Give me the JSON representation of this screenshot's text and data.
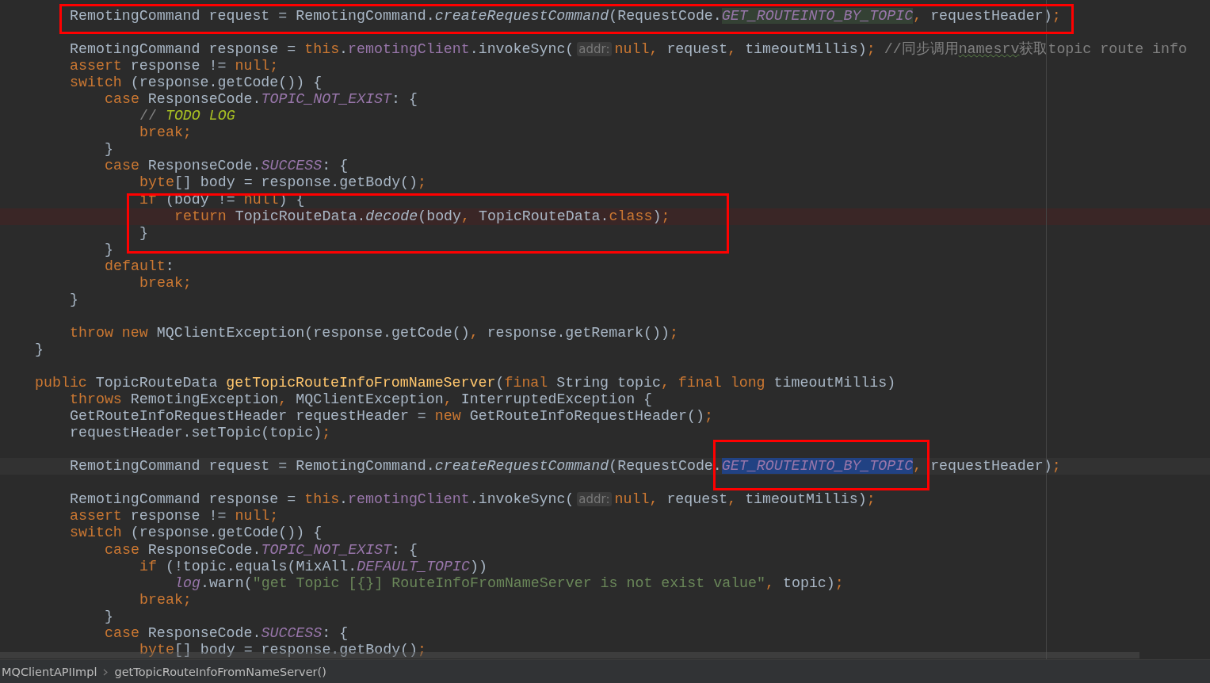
{
  "editor": {
    "lines": [
      {
        "kind": "group",
        "children": [
          {
            "kind": "code",
            "tokens": [
              {
                "kind": "plain",
                "text": "RemotingCommand request = RemotingCommand."
              },
              {
                "kind": "static",
                "text": "createRequestCommand"
              },
              {
                "kind": "plain",
                "text": "(RequestCode."
              },
              {
                "kind": "const-usage",
                "text": "GET_ROUTEINTO_BY_TOPIC"
              },
              {
                "kind": "kw",
                "text": ", "
              },
              {
                "kind": "plain",
                "text": "requestHeader)"
              },
              {
                "kind": "kw",
                "text": ";"
              }
            ]
          },
          {
            "kind": "blank"
          },
          {
            "kind": "code",
            "tokens": [
              {
                "kind": "plain",
                "text": "RemotingCommand response = "
              },
              {
                "kind": "kw",
                "text": "this"
              },
              {
                "kind": "plain",
                "text": "."
              },
              {
                "kind": "field",
                "text": "remotingClient"
              },
              {
                "kind": "plain",
                "text": ".invokeSync("
              },
              {
                "kind": "hint",
                "text": "addr:"
              },
              {
                "kind": "kw",
                "text": "null, "
              },
              {
                "kind": "plain",
                "text": "request"
              },
              {
                "kind": "kw",
                "text": ", "
              },
              {
                "kind": "plain",
                "text": "timeoutMillis)"
              },
              {
                "kind": "kw",
                "text": "; "
              },
              {
                "kind": "comment",
                "text": "//同步调用"
              },
              {
                "kind": "typo",
                "text": "namesrv"
              },
              {
                "kind": "comment",
                "text": "获取topic route info"
              }
            ]
          },
          {
            "kind": "code",
            "tokens": [
              {
                "kind": "kw",
                "text": "assert "
              },
              {
                "kind": "plain",
                "text": "response != "
              },
              {
                "kind": "kw",
                "text": "null;"
              }
            ]
          },
          {
            "kind": "code",
            "tokens": [
              {
                "kind": "kw",
                "text": "switch "
              },
              {
                "kind": "plain",
                "text": "(response.getCode()) {"
              }
            ],
            "children": [
              {
                "kind": "code",
                "tokens": [
                  {
                    "kind": "kw",
                    "text": "case "
                  },
                  {
                    "kind": "plain",
                    "text": "ResponseCode."
                  },
                  {
                    "kind": "const",
                    "text": "TOPIC_NOT_EXIST"
                  },
                  {
                    "kind": "plain",
                    "text": ": {"
                  }
                ],
                "children": [
                  {
                    "kind": "code",
                    "tokens": [
                      {
                        "kind": "comment",
                        "text": "// "
                      },
                      {
                        "kind": "todo",
                        "text": "TODO LOG"
                      }
                    ]
                  },
                  {
                    "kind": "code",
                    "tokens": [
                      {
                        "kind": "kw",
                        "text": "break;"
                      }
                    ]
                  }
                ]
              },
              {
                "kind": "code",
                "tokens": [
                  {
                    "kind": "plain",
                    "text": "}"
                  }
                ]
              },
              {
                "kind": "code",
                "tokens": [
                  {
                    "kind": "kw",
                    "text": "case "
                  },
                  {
                    "kind": "plain",
                    "text": "ResponseCode."
                  },
                  {
                    "kind": "const",
                    "text": "SUCCESS"
                  },
                  {
                    "kind": "plain",
                    "text": ": {"
                  }
                ],
                "children": [
                  {
                    "kind": "code",
                    "tokens": [
                      {
                        "kind": "kw",
                        "text": "byte"
                      },
                      {
                        "kind": "plain",
                        "text": "[] body = response.getBody()"
                      },
                      {
                        "kind": "kw",
                        "text": ";"
                      }
                    ]
                  },
                  {
                    "kind": "code",
                    "tokens": [
                      {
                        "kind": "kw",
                        "text": "if "
                      },
                      {
                        "kind": "plain",
                        "text": "(body != "
                      },
                      {
                        "kind": "kw",
                        "text": "null"
                      },
                      {
                        "kind": "plain",
                        "text": ") {"
                      }
                    ],
                    "children": [
                      {
                        "kind": "error-line",
                        "tokens": [
                          {
                            "kind": "kw",
                            "text": "return "
                          },
                          {
                            "kind": "plain",
                            "text": "TopicRouteData."
                          },
                          {
                            "kind": "static",
                            "text": "decode"
                          },
                          {
                            "kind": "plain",
                            "text": "(body"
                          },
                          {
                            "kind": "kw",
                            "text": ", "
                          },
                          {
                            "kind": "plain",
                            "text": "TopicRouteData."
                          },
                          {
                            "kind": "kw",
                            "text": "class"
                          },
                          {
                            "kind": "plain",
                            "text": ")"
                          },
                          {
                            "kind": "kw",
                            "text": ";"
                          }
                        ]
                      }
                    ]
                  },
                  {
                    "kind": "code",
                    "tokens": [
                      {
                        "kind": "plain",
                        "text": "}"
                      }
                    ]
                  }
                ]
              },
              {
                "kind": "code",
                "tokens": [
                  {
                    "kind": "plain",
                    "text": "}"
                  }
                ]
              },
              {
                "kind": "code",
                "tokens": [
                  {
                    "kind": "kw",
                    "text": "default"
                  },
                  {
                    "kind": "plain",
                    "text": ":"
                  }
                ],
                "children": [
                  {
                    "kind": "code",
                    "tokens": [
                      {
                        "kind": "kw",
                        "text": "break;"
                      }
                    ]
                  }
                ]
              }
            ]
          },
          {
            "kind": "code",
            "tokens": [
              {
                "kind": "plain",
                "text": "}"
              }
            ]
          },
          {
            "kind": "blank"
          },
          {
            "kind": "code",
            "tokens": [
              {
                "kind": "kw",
                "text": "throw new "
              },
              {
                "kind": "plain",
                "text": "MQClientException(response.getCode()"
              },
              {
                "kind": "kw",
                "text": ", "
              },
              {
                "kind": "plain",
                "text": "response.getRemark())"
              },
              {
                "kind": "kw",
                "text": ";"
              }
            ]
          }
        ]
      },
      {
        "kind": "code",
        "tokens": [
          {
            "kind": "plain",
            "text": "}"
          }
        ]
      },
      {
        "kind": "blank"
      },
      {
        "kind": "code",
        "tokens": [
          {
            "kind": "kw",
            "text": "public "
          },
          {
            "kind": "plain",
            "text": "TopicRouteData "
          },
          {
            "kind": "decl",
            "text": "getTopicRouteInfoFromNameServer"
          },
          {
            "kind": "plain",
            "text": "("
          },
          {
            "kind": "kw",
            "text": "final "
          },
          {
            "kind": "plain",
            "text": "String topic"
          },
          {
            "kind": "kw",
            "text": ", final long "
          },
          {
            "kind": "plain",
            "text": "timeoutMillis)"
          }
        ],
        "children": [
          {
            "kind": "code",
            "tokens": [
              {
                "kind": "kw",
                "text": "throws "
              },
              {
                "kind": "plain",
                "text": "RemotingException"
              },
              {
                "kind": "kw",
                "text": ", "
              },
              {
                "kind": "plain",
                "text": "MQClientException"
              },
              {
                "kind": "kw",
                "text": ", "
              },
              {
                "kind": "plain",
                "text": "InterruptedException {"
              }
            ]
          },
          {
            "kind": "code",
            "tokens": [
              {
                "kind": "plain",
                "text": "GetRouteInfoRequestHeader requestHeader = "
              },
              {
                "kind": "kw",
                "text": "new "
              },
              {
                "kind": "plain",
                "text": "GetRouteInfoRequestHeader()"
              },
              {
                "kind": "kw",
                "text": ";"
              }
            ]
          },
          {
            "kind": "code",
            "tokens": [
              {
                "kind": "plain",
                "text": "requestHeader.setTopic(topic)"
              },
              {
                "kind": "kw",
                "text": ";"
              }
            ]
          },
          {
            "kind": "blank"
          },
          {
            "kind": "caret-line",
            "tokens": [
              {
                "kind": "plain",
                "text": "RemotingCommand request = RemotingCommand."
              },
              {
                "kind": "static",
                "text": "createRequestCommand"
              },
              {
                "kind": "plain",
                "text": "(RequestCode."
              },
              {
                "kind": "const-selected",
                "text": "GET_ROUTEINTO_BY_TOPIC"
              },
              {
                "kind": "kw",
                "text": ", "
              },
              {
                "kind": "plain",
                "text": "requestHeader)"
              },
              {
                "kind": "kw",
                "text": ";"
              }
            ]
          },
          {
            "kind": "blank"
          },
          {
            "kind": "code",
            "tokens": [
              {
                "kind": "plain",
                "text": "RemotingCommand response = "
              },
              {
                "kind": "kw",
                "text": "this"
              },
              {
                "kind": "plain",
                "text": "."
              },
              {
                "kind": "field",
                "text": "remotingClient"
              },
              {
                "kind": "plain",
                "text": ".invokeSync("
              },
              {
                "kind": "hint",
                "text": "addr:"
              },
              {
                "kind": "kw",
                "text": "null, "
              },
              {
                "kind": "plain",
                "text": "request"
              },
              {
                "kind": "kw",
                "text": ", "
              },
              {
                "kind": "plain",
                "text": "timeoutMillis)"
              },
              {
                "kind": "kw",
                "text": ";"
              }
            ]
          },
          {
            "kind": "code",
            "tokens": [
              {
                "kind": "kw",
                "text": "assert "
              },
              {
                "kind": "plain",
                "text": "response != "
              },
              {
                "kind": "kw",
                "text": "null;"
              }
            ]
          },
          {
            "kind": "code",
            "tokens": [
              {
                "kind": "kw",
                "text": "switch "
              },
              {
                "kind": "plain",
                "text": "(response.getCode()) {"
              }
            ],
            "children": [
              {
                "kind": "code",
                "tokens": [
                  {
                    "kind": "kw",
                    "text": "case "
                  },
                  {
                    "kind": "plain",
                    "text": "ResponseCode."
                  },
                  {
                    "kind": "const",
                    "text": "TOPIC_NOT_EXIST"
                  },
                  {
                    "kind": "plain",
                    "text": ": {"
                  }
                ],
                "children": [
                  {
                    "kind": "code",
                    "tokens": [
                      {
                        "kind": "kw",
                        "text": "if "
                      },
                      {
                        "kind": "plain",
                        "text": "(!topic.equals(MixAll."
                      },
                      {
                        "kind": "const",
                        "text": "DEFAULT_TOPIC"
                      },
                      {
                        "kind": "plain",
                        "text": "))"
                      }
                    ],
                    "children": [
                      {
                        "kind": "code",
                        "tokens": [
                          {
                            "kind": "const",
                            "text": "log"
                          },
                          {
                            "kind": "plain",
                            "text": ".warn("
                          },
                          {
                            "kind": "str",
                            "text": "\"get Topic [{}] RouteInfoFromNameServer is not exist value\""
                          },
                          {
                            "kind": "kw",
                            "text": ", "
                          },
                          {
                            "kind": "plain",
                            "text": "topic)"
                          },
                          {
                            "kind": "kw",
                            "text": ";"
                          }
                        ]
                      }
                    ]
                  },
                  {
                    "kind": "code",
                    "tokens": [
                      {
                        "kind": "kw",
                        "text": "break;"
                      }
                    ]
                  }
                ]
              },
              {
                "kind": "code",
                "tokens": [
                  {
                    "kind": "plain",
                    "text": "}"
                  }
                ]
              },
              {
                "kind": "code",
                "tokens": [
                  {
                    "kind": "kw",
                    "text": "case "
                  },
                  {
                    "kind": "plain",
                    "text": "ResponseCode."
                  },
                  {
                    "kind": "const",
                    "text": "SUCCESS"
                  },
                  {
                    "kind": "plain",
                    "text": ": {"
                  }
                ],
                "children": [
                  {
                    "kind": "code",
                    "tokens": [
                      {
                        "kind": "kw",
                        "text": "byte"
                      },
                      {
                        "kind": "plain",
                        "text": "[] body = response.getBody()"
                      },
                      {
                        "kind": "kw",
                        "text": ";"
                      }
                    ]
                  }
                ]
              }
            ]
          }
        ]
      }
    ]
  },
  "breadcrumbs": [
    "MQClientAPIImpl",
    "getTopicRouteInfoFromNameServer()"
  ]
}
